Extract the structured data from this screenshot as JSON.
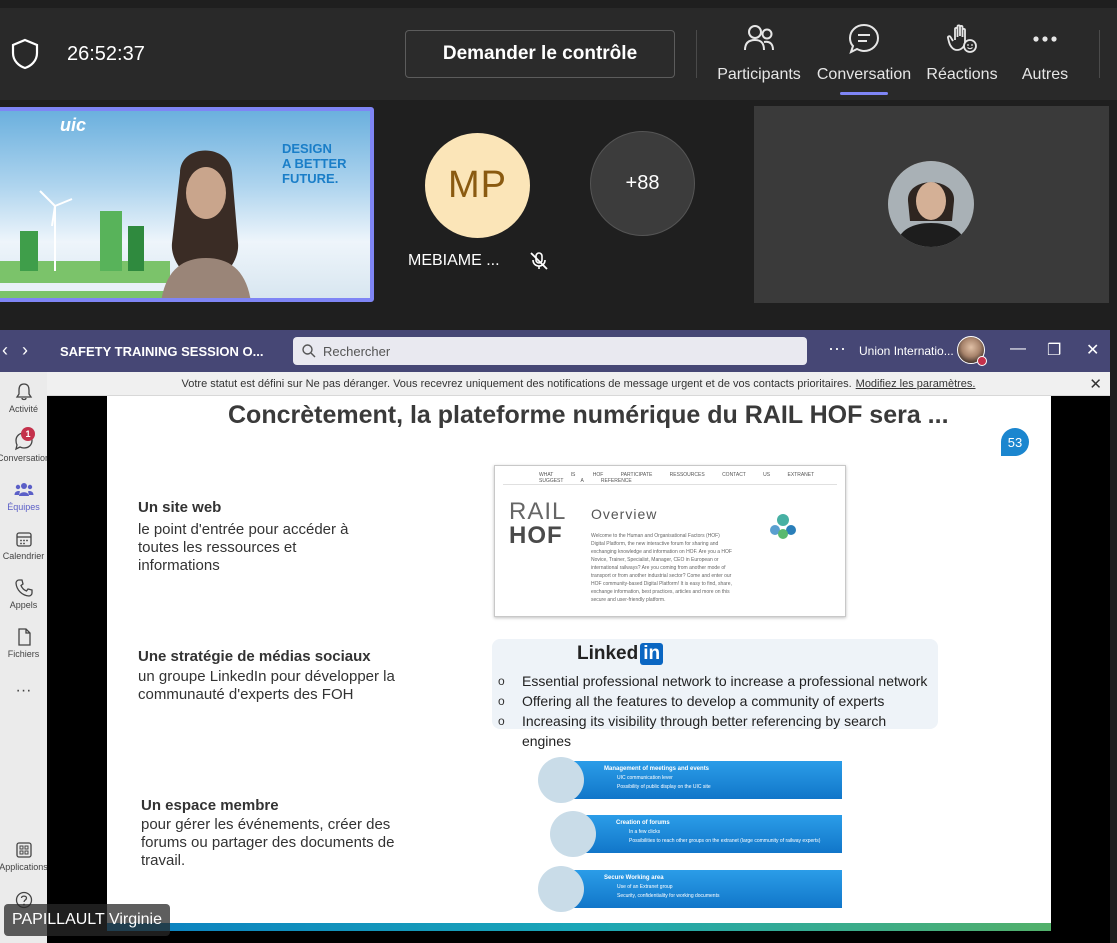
{
  "meeting": {
    "timer": "26:52:37",
    "request_control": "Demander le contrôle",
    "toolbar": [
      {
        "label": "Participants",
        "icon": "people-icon"
      },
      {
        "label": "Conversation",
        "icon": "chat-icon"
      },
      {
        "label": "Réactions",
        "icon": "raise-hand-icon"
      },
      {
        "label": "Autres",
        "icon": "more-icon"
      }
    ],
    "active_tab": "Conversation"
  },
  "participants": {
    "main_video": {
      "logo": "uic",
      "tagline": [
        "DESIGN",
        "A BETTER",
        "FUTURE."
      ]
    },
    "avatar_initials": "MP",
    "avatar_name": "MEBIAME ...",
    "overflow_count": "+88"
  },
  "teams": {
    "title": "SAFETY TRAINING SESSION O...",
    "search_placeholder": "Rechercher",
    "org": "Union Internatio...",
    "rail": [
      {
        "label": "Activité",
        "icon": "bell-icon"
      },
      {
        "label": "Conversation",
        "icon": "chat-icon",
        "badge": "1"
      },
      {
        "label": "Équipes",
        "icon": "teams-icon"
      },
      {
        "label": "Calendrier",
        "icon": "calendar-icon"
      },
      {
        "label": "Appels",
        "icon": "phone-icon"
      },
      {
        "label": "Fichiers",
        "icon": "file-icon"
      },
      {
        "label": "Applications",
        "icon": "apps-icon"
      }
    ],
    "notification": "Votre statut est défini sur Ne pas déranger. Vous recevrez uniquement des notifications de message urgent et de vos contacts prioritaires.",
    "notification_link": "Modifiez les paramètres."
  },
  "slide": {
    "title": "Concrètement, la plateforme numérique du RAIL HOF sera ...",
    "page": "53",
    "sections": [
      {
        "heading": "Un site web",
        "body": "le point d'entrée pour accéder à toutes les ressources et informations"
      },
      {
        "heading": "Une stratégie de médias sociaux",
        "body": "un groupe LinkedIn pour développer la communauté d'experts des FOH"
      },
      {
        "heading": "Un espace membre",
        "body": "pour gérer les événements, créer des forums ou partager des documents de travail."
      }
    ],
    "website": {
      "nav": "WHAT IS HOF PARTICIPATE RESSOURCES CONTACT US EXTRANET SUGGEST A REFERENCE",
      "logo_top": "RAIL",
      "logo_bottom": "HOF",
      "overview": "Overview",
      "text": "Welcome to the Human and Organisational Factors (HOF) Digital Platform, the new interactive forum for sharing and exchanging knowledge and information on HOF. Are you a HOF Novice, Trainer, Specialist, Manager, CEO in European or international railways? Are you coming from another mode of transport or from another industrial sector? Come and enter our HOF community-based Digital Platform! It is easy to find, share, exchange information, best practices, articles and more on this secure and user-friendly platform."
    },
    "linkedin": {
      "logo": "Linked",
      "logo_in": "in",
      "points": [
        "Essential professional network to increase a professional network",
        "Offering all the features to develop a community of experts",
        "Increasing its visibility through better referencing by search engines"
      ]
    },
    "member": [
      {
        "title": "Management of meetings and events",
        "lines": [
          "UIC communication lever",
          "Possibility of public display on the UIC site"
        ]
      },
      {
        "title": "Creation of forums",
        "lines": [
          "In a few clicks",
          "Possibilities to reach other groups on the extranet (large community of railway experts)"
        ]
      },
      {
        "title": "Secure Working area",
        "lines": [
          "Use of an Extranet group",
          "Security, confidentiality for working documents"
        ]
      }
    ]
  },
  "presenter": "PAPILLAULT Virginie",
  "colors": {
    "accent": "#7f85f5",
    "teams_header": "#464775",
    "slide_blue": "#1b86cf"
  }
}
